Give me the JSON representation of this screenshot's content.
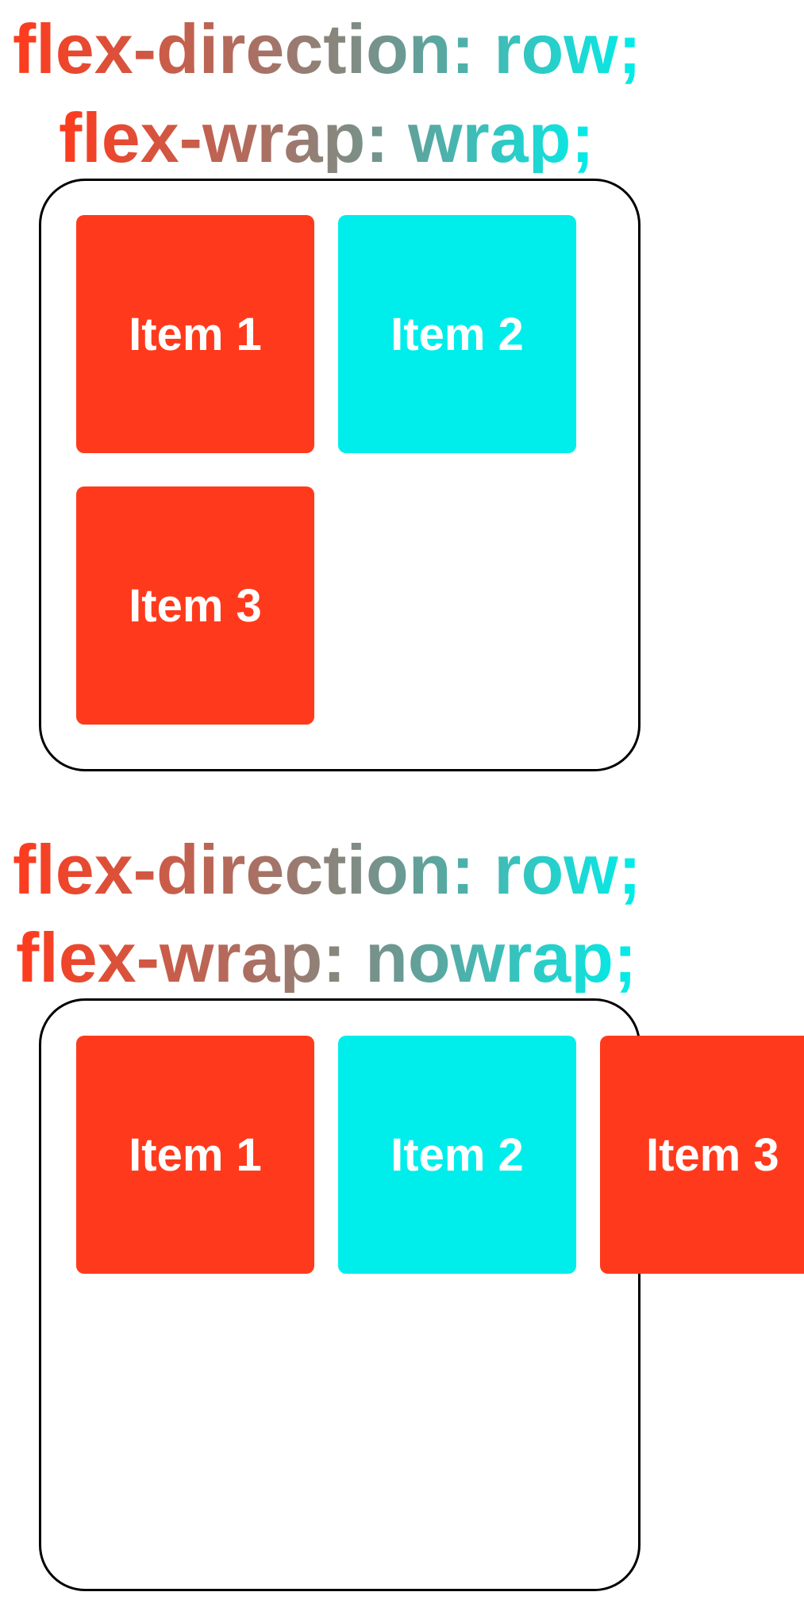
{
  "colors": {
    "red": "#ff3a1c",
    "cyan": "#00eeeb",
    "border": "#000000",
    "item_text": "#ffffff"
  },
  "example_wrap": {
    "direction_line": "flex-direction: row;",
    "wrap_line": "flex-wrap: wrap;",
    "items": [
      {
        "label": "Item 1",
        "color": "red"
      },
      {
        "label": "Item 2",
        "color": "cyan"
      },
      {
        "label": "Item 3",
        "color": "red"
      }
    ]
  },
  "example_nowrap": {
    "direction_line": "flex-direction: row;",
    "wrap_line": "flex-wrap: nowrap;",
    "items": [
      {
        "label": "Item 1",
        "color": "red"
      },
      {
        "label": "Item 2",
        "color": "cyan"
      },
      {
        "label": "Item 3",
        "color": "red"
      }
    ]
  }
}
